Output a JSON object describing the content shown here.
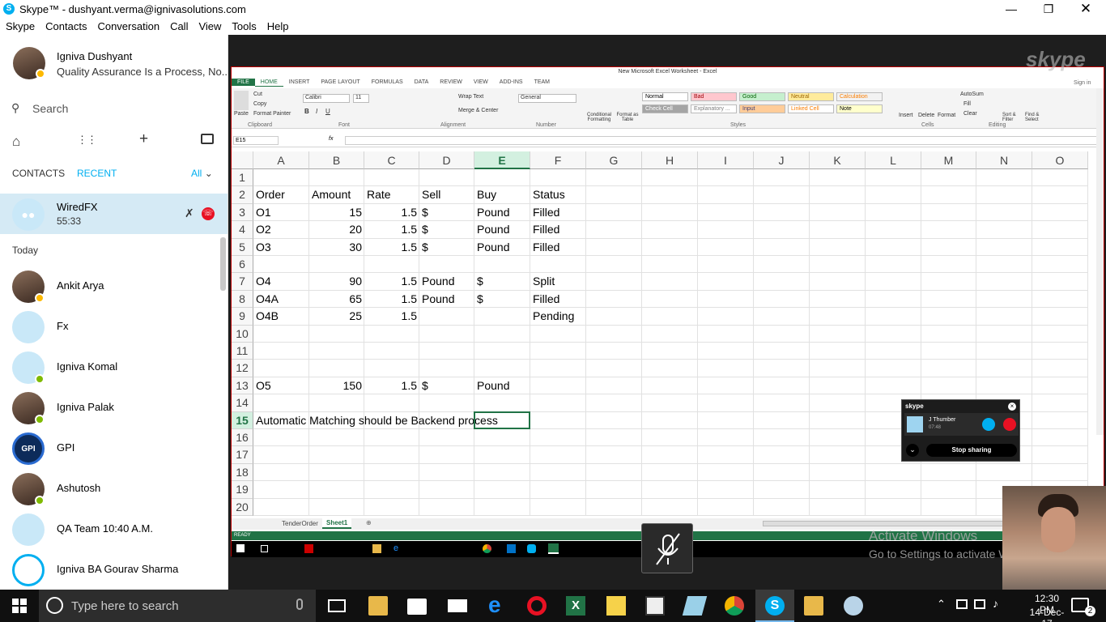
{
  "window": {
    "title": "Skype™ - dushyant.verma@ignivasolutions.com"
  },
  "menu": [
    "Skype",
    "Contacts",
    "Conversation",
    "Call",
    "View",
    "Tools",
    "Help"
  ],
  "profile": {
    "name": "Igniva Dushyant",
    "mood": "Quality Assurance Is a Process, No..."
  },
  "search": {
    "placeholder": "Search"
  },
  "tabs": {
    "contacts": "CONTACTS",
    "recent": "RECENT",
    "filter": "All"
  },
  "active_call": {
    "name": "WiredFX",
    "duration": "55:33"
  },
  "section_today": "Today",
  "recents": [
    {
      "name": "Ankit Arya",
      "type": "person",
      "status": "away"
    },
    {
      "name": "Fx",
      "type": "group",
      "status": ""
    },
    {
      "name": "Igniva Komal",
      "type": "default",
      "status": "online"
    },
    {
      "name": "Igniva Palak",
      "type": "person",
      "status": "online"
    },
    {
      "name": "GPI",
      "type": "logo",
      "status": ""
    },
    {
      "name": "Ashutosh",
      "type": "person",
      "status": "online"
    },
    {
      "name": "QA Team 10:40 A.M.",
      "type": "group",
      "status": ""
    },
    {
      "name": "Igniva BA Gourav Sharma",
      "type": "ring",
      "status": ""
    }
  ],
  "excel": {
    "title": "New Microsoft Excel Worksheet - Excel",
    "ribbon_tabs": [
      "FILE",
      "HOME",
      "INSERT",
      "PAGE LAYOUT",
      "FORMULAS",
      "DATA",
      "REVIEW",
      "VIEW",
      "ADD-INS",
      "TEAM"
    ],
    "sign_in": "Sign in",
    "clipboard": {
      "paste": "Paste",
      "cut": "Cut",
      "copy": "Copy",
      "format_painter": "Format Painter",
      "group": "Clipboard"
    },
    "font": {
      "name": "Calibri",
      "size": "11",
      "group": "Font"
    },
    "alignment": {
      "wrap": "Wrap Text",
      "merge": "Merge & Center",
      "group": "Alignment"
    },
    "number": {
      "format": "General",
      "group": "Number"
    },
    "styles": [
      {
        "label": "Normal",
        "bg": "#ffffff",
        "fg": "#000000"
      },
      {
        "label": "Bad",
        "bg": "#ffc7ce",
        "fg": "#9c0006"
      },
      {
        "label": "Good",
        "bg": "#c6efce",
        "fg": "#006100"
      },
      {
        "label": "Neutral",
        "bg": "#ffeb9c",
        "fg": "#9c6500"
      },
      {
        "label": "Calculation",
        "bg": "#f2f2f2",
        "fg": "#fa7d00"
      },
      {
        "label": "Check Cell",
        "bg": "#a5a5a5",
        "fg": "#ffffff"
      },
      {
        "label": "Explanatory ...",
        "bg": "#ffffff",
        "fg": "#7f7f7f"
      },
      {
        "label": "Input",
        "bg": "#ffcc99",
        "fg": "#3f3f76"
      },
      {
        "label": "Linked Cell",
        "bg": "#ffffff",
        "fg": "#fa7d00"
      },
      {
        "label": "Note",
        "bg": "#ffffcc",
        "fg": "#000000"
      }
    ],
    "styles_group": "Styles",
    "cond_format": "Conditional Formatting",
    "format_table": "Format as Table",
    "cells": {
      "insert": "Insert",
      "delete": "Delete",
      "format": "Format",
      "group": "Cells"
    },
    "editing": {
      "autosum": "AutoSum",
      "fill": "Fill",
      "clear": "Clear",
      "sort": "Sort & Filter",
      "find": "Find & Select",
      "group": "Editing"
    },
    "name_box": "E15",
    "fx": "fx",
    "columns": [
      "A",
      "B",
      "C",
      "D",
      "E",
      "F",
      "G",
      "H",
      "I",
      "J",
      "K",
      "L",
      "M",
      "N",
      "O"
    ],
    "rows": [
      "1",
      "2",
      "3",
      "4",
      "5",
      "6",
      "7",
      "8",
      "9",
      "10",
      "11",
      "12",
      "13",
      "14",
      "15",
      "16",
      "17",
      "18",
      "19",
      "20"
    ],
    "cells_data": [
      {
        "r": 2,
        "c": "A",
        "v": "Order"
      },
      {
        "r": 2,
        "c": "B",
        "v": "Amount"
      },
      {
        "r": 2,
        "c": "C",
        "v": "Rate"
      },
      {
        "r": 2,
        "c": "D",
        "v": "Sell"
      },
      {
        "r": 2,
        "c": "E",
        "v": "Buy"
      },
      {
        "r": 2,
        "c": "F",
        "v": "Status"
      },
      {
        "r": 3,
        "c": "A",
        "v": "O1"
      },
      {
        "r": 3,
        "c": "B",
        "v": "15",
        "num": true
      },
      {
        "r": 3,
        "c": "C",
        "v": "1.5",
        "num": true
      },
      {
        "r": 3,
        "c": "D",
        "v": "$"
      },
      {
        "r": 3,
        "c": "E",
        "v": "Pound"
      },
      {
        "r": 3,
        "c": "F",
        "v": "Filled"
      },
      {
        "r": 4,
        "c": "A",
        "v": "O2"
      },
      {
        "r": 4,
        "c": "B",
        "v": "20",
        "num": true
      },
      {
        "r": 4,
        "c": "C",
        "v": "1.5",
        "num": true
      },
      {
        "r": 4,
        "c": "D",
        "v": "$"
      },
      {
        "r": 4,
        "c": "E",
        "v": "Pound"
      },
      {
        "r": 4,
        "c": "F",
        "v": "Filled"
      },
      {
        "r": 5,
        "c": "A",
        "v": "O3"
      },
      {
        "r": 5,
        "c": "B",
        "v": "30",
        "num": true
      },
      {
        "r": 5,
        "c": "C",
        "v": "1.5",
        "num": true
      },
      {
        "r": 5,
        "c": "D",
        "v": "$"
      },
      {
        "r": 5,
        "c": "E",
        "v": "Pound"
      },
      {
        "r": 5,
        "c": "F",
        "v": "Filled"
      },
      {
        "r": 7,
        "c": "A",
        "v": "O4"
      },
      {
        "r": 7,
        "c": "B",
        "v": "90",
        "num": true
      },
      {
        "r": 7,
        "c": "C",
        "v": "1.5",
        "num": true
      },
      {
        "r": 7,
        "c": "D",
        "v": "Pound"
      },
      {
        "r": 7,
        "c": "E",
        "v": "$"
      },
      {
        "r": 7,
        "c": "F",
        "v": "Split"
      },
      {
        "r": 8,
        "c": "A",
        "v": "O4A"
      },
      {
        "r": 8,
        "c": "B",
        "v": "65",
        "num": true
      },
      {
        "r": 8,
        "c": "C",
        "v": "1.5",
        "num": true
      },
      {
        "r": 8,
        "c": "D",
        "v": "Pound"
      },
      {
        "r": 8,
        "c": "E",
        "v": "$"
      },
      {
        "r": 8,
        "c": "F",
        "v": "Filled"
      },
      {
        "r": 9,
        "c": "A",
        "v": "O4B"
      },
      {
        "r": 9,
        "c": "B",
        "v": "25",
        "num": true
      },
      {
        "r": 9,
        "c": "C",
        "v": "1.5",
        "num": true
      },
      {
        "r": 9,
        "c": "F",
        "v": "Pending"
      },
      {
        "r": 13,
        "c": "A",
        "v": "O5"
      },
      {
        "r": 13,
        "c": "B",
        "v": "150",
        "num": true
      },
      {
        "r": 13,
        "c": "C",
        "v": "1.5",
        "num": true
      },
      {
        "r": 13,
        "c": "D",
        "v": "$"
      },
      {
        "r": 13,
        "c": "E",
        "v": "Pound"
      },
      {
        "r": 15,
        "c": "A",
        "v": "Automatic Matching should be Backend process"
      }
    ],
    "selected": {
      "r": 15,
      "c": "E"
    },
    "sheet_tabs": [
      "TenderOrder",
      "Sheet1"
    ],
    "active_sheet": "Sheet1",
    "status": "READY"
  },
  "share_widget": {
    "name": "J Thumber",
    "duration": "07:48",
    "stop": "Stop sharing"
  },
  "watermark": {
    "line1": "Activate Windows",
    "line2": "Go to Settings to activate Windows."
  },
  "taskbar": {
    "search_placeholder": "Type here to search",
    "time": "12:30 PM",
    "date": "14-Dec-17",
    "notifications": "2"
  },
  "colors": {
    "skype_blue": "#00aff0",
    "excel_green": "#217346",
    "red": "#e81123",
    "online": "#7fba00",
    "away": "#fdb900"
  }
}
